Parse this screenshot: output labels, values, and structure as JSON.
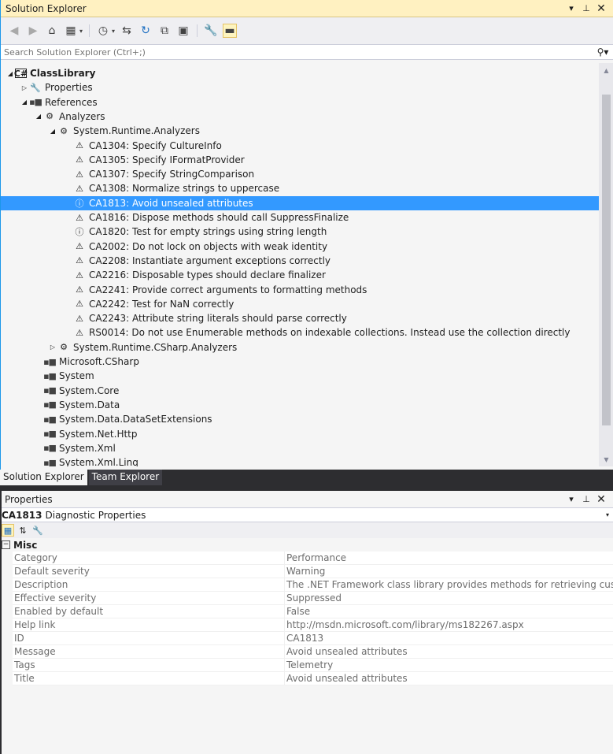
{
  "solution_explorer": {
    "title": "Solution Explorer",
    "search_placeholder": "Search Solution Explorer (Ctrl+;)",
    "tree": [
      {
        "label": "ClassLibrary",
        "level": 0,
        "expander": "open",
        "icon": "csharp-project-icon",
        "bold": true
      },
      {
        "label": "Properties",
        "level": 1,
        "expander": "closed",
        "icon": "wrench-icon"
      },
      {
        "label": "References",
        "level": 1,
        "expander": "open",
        "icon": "reference-icon"
      },
      {
        "label": "Analyzers",
        "level": 2,
        "expander": "open",
        "icon": "analyzer-icon"
      },
      {
        "label": "System.Runtime.Analyzers",
        "level": 3,
        "expander": "open",
        "icon": "analyzer-icon"
      },
      {
        "label": "CA1304: Specify CultureInfo",
        "level": 4,
        "icon": "rule-warning-icon"
      },
      {
        "label": "CA1305: Specify IFormatProvider",
        "level": 4,
        "icon": "rule-warning-icon"
      },
      {
        "label": "CA1307: Specify StringComparison",
        "level": 4,
        "icon": "rule-warning-icon"
      },
      {
        "label": "CA1308: Normalize strings to uppercase",
        "level": 4,
        "icon": "rule-warning-icon"
      },
      {
        "label": "CA1813: Avoid unsealed attributes",
        "level": 4,
        "icon": "rule-info-icon",
        "selected": true
      },
      {
        "label": "CA1816: Dispose methods should call SuppressFinalize",
        "level": 4,
        "icon": "rule-warning-icon"
      },
      {
        "label": "CA1820: Test for empty strings using string length",
        "level": 4,
        "icon": "rule-info-icon"
      },
      {
        "label": "CA2002: Do not lock on objects with weak identity",
        "level": 4,
        "icon": "rule-warning-icon"
      },
      {
        "label": "CA2208: Instantiate argument exceptions correctly",
        "level": 4,
        "icon": "rule-warning-icon"
      },
      {
        "label": "CA2216: Disposable types should declare finalizer",
        "level": 4,
        "icon": "rule-warning-icon"
      },
      {
        "label": "CA2241: Provide correct arguments to formatting methods",
        "level": 4,
        "icon": "rule-warning-icon"
      },
      {
        "label": "CA2242: Test for NaN correctly",
        "level": 4,
        "icon": "rule-warning-icon"
      },
      {
        "label": "CA2243: Attribute string literals should parse correctly",
        "level": 4,
        "icon": "rule-warning-icon"
      },
      {
        "label": "RS0014: Do not use Enumerable methods on indexable collections. Instead use the collection directly",
        "level": 4,
        "icon": "rule-warning-icon"
      },
      {
        "label": "System.Runtime.CSharp.Analyzers",
        "level": 3,
        "expander": "closed",
        "icon": "analyzer-icon"
      },
      {
        "label": "Microsoft.CSharp",
        "level": 2,
        "icon": "reference-icon"
      },
      {
        "label": "System",
        "level": 2,
        "icon": "reference-icon"
      },
      {
        "label": "System.Core",
        "level": 2,
        "icon": "reference-icon"
      },
      {
        "label": "System.Data",
        "level": 2,
        "icon": "reference-icon"
      },
      {
        "label": "System.Data.DataSetExtensions",
        "level": 2,
        "icon": "reference-icon"
      },
      {
        "label": "System.Net.Http",
        "level": 2,
        "icon": "reference-icon"
      },
      {
        "label": "System.Xml",
        "level": 2,
        "icon": "reference-icon"
      },
      {
        "label": "System.Xml.Linq",
        "level": 2,
        "icon": "reference-icon"
      }
    ]
  },
  "tabs": [
    {
      "label": "Solution Explorer",
      "active": true
    },
    {
      "label": "Team Explorer",
      "active": false
    }
  ],
  "properties": {
    "title": "Properties",
    "object_name": "CA1813",
    "object_type": "Diagnostic Properties",
    "category": "Misc",
    "rows": [
      {
        "name": "Category",
        "value": "Performance"
      },
      {
        "name": "Default severity",
        "value": "Warning"
      },
      {
        "name": "Description",
        "value": "The .NET Framework class library provides methods for retrieving custom attributes"
      },
      {
        "name": "Effective severity",
        "value": "Suppressed"
      },
      {
        "name": "Enabled by default",
        "value": "False"
      },
      {
        "name": "Help link",
        "value": "http://msdn.microsoft.com/library/ms182267.aspx"
      },
      {
        "name": "ID",
        "value": "CA1813"
      },
      {
        "name": "Message",
        "value": "Avoid unsealed attributes"
      },
      {
        "name": "Tags",
        "value": "Telemetry"
      },
      {
        "name": "Title",
        "value": "Avoid unsealed attributes"
      }
    ]
  },
  "colors": {
    "selection": "#3399ff",
    "title_active": "#fff1c1",
    "frame": "#2d2d30"
  }
}
